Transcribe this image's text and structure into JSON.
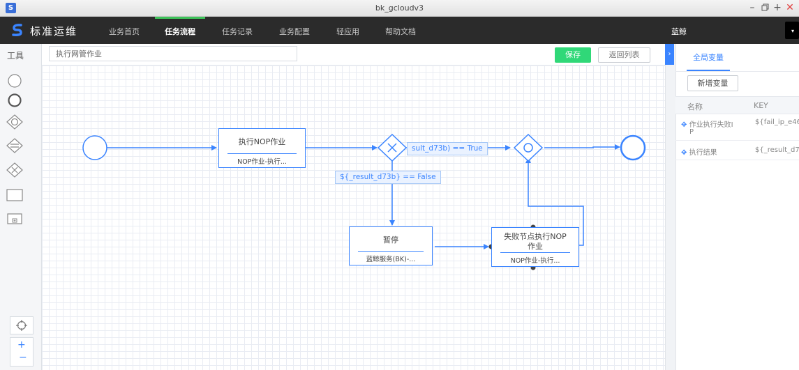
{
  "window": {
    "title": "bk_gcloudv3",
    "app_icon": "S"
  },
  "navbar": {
    "brand": "标准运维",
    "items": [
      "业务首页",
      "任务流程",
      "任务记录",
      "业务配置",
      "轻应用",
      "帮助文档"
    ],
    "active_index": 1,
    "user": "蓝鲸"
  },
  "toolbox": {
    "label": "工具"
  },
  "editor": {
    "flow_name": "执行网管作业",
    "save_label": "保存",
    "back_label": "返回列表"
  },
  "flow": {
    "nodes": {
      "task1": {
        "title": "执行NOP作业",
        "subtitle": "NOP作业-执行..."
      },
      "pause": {
        "title": "暂停",
        "subtitle": "蓝鲸服务(BK)-..."
      },
      "task2": {
        "title_line1": "失败节点执行NOP",
        "title_line2": "作业",
        "subtitle": "NOP作业-执行..."
      }
    },
    "conditions": {
      "true_label": "sult_d73b) == True",
      "false_label": "${_result_d73b} == False"
    }
  },
  "right_panel": {
    "tab": "全局变量",
    "add_button": "新增变量",
    "columns": [
      "名称",
      "KEY"
    ],
    "rows": [
      {
        "name_line1": "作业执行失败I",
        "name_line2": "P",
        "key": "${fail_ip_e46"
      },
      {
        "name_line1": "执行结果",
        "name_line2": "",
        "key": "${_result_d7"
      }
    ]
  },
  "colors": {
    "accent": "#3a84ff",
    "save": "#30d878",
    "nav_active": "#3ec35a",
    "navbar": "#2b2b2b"
  }
}
